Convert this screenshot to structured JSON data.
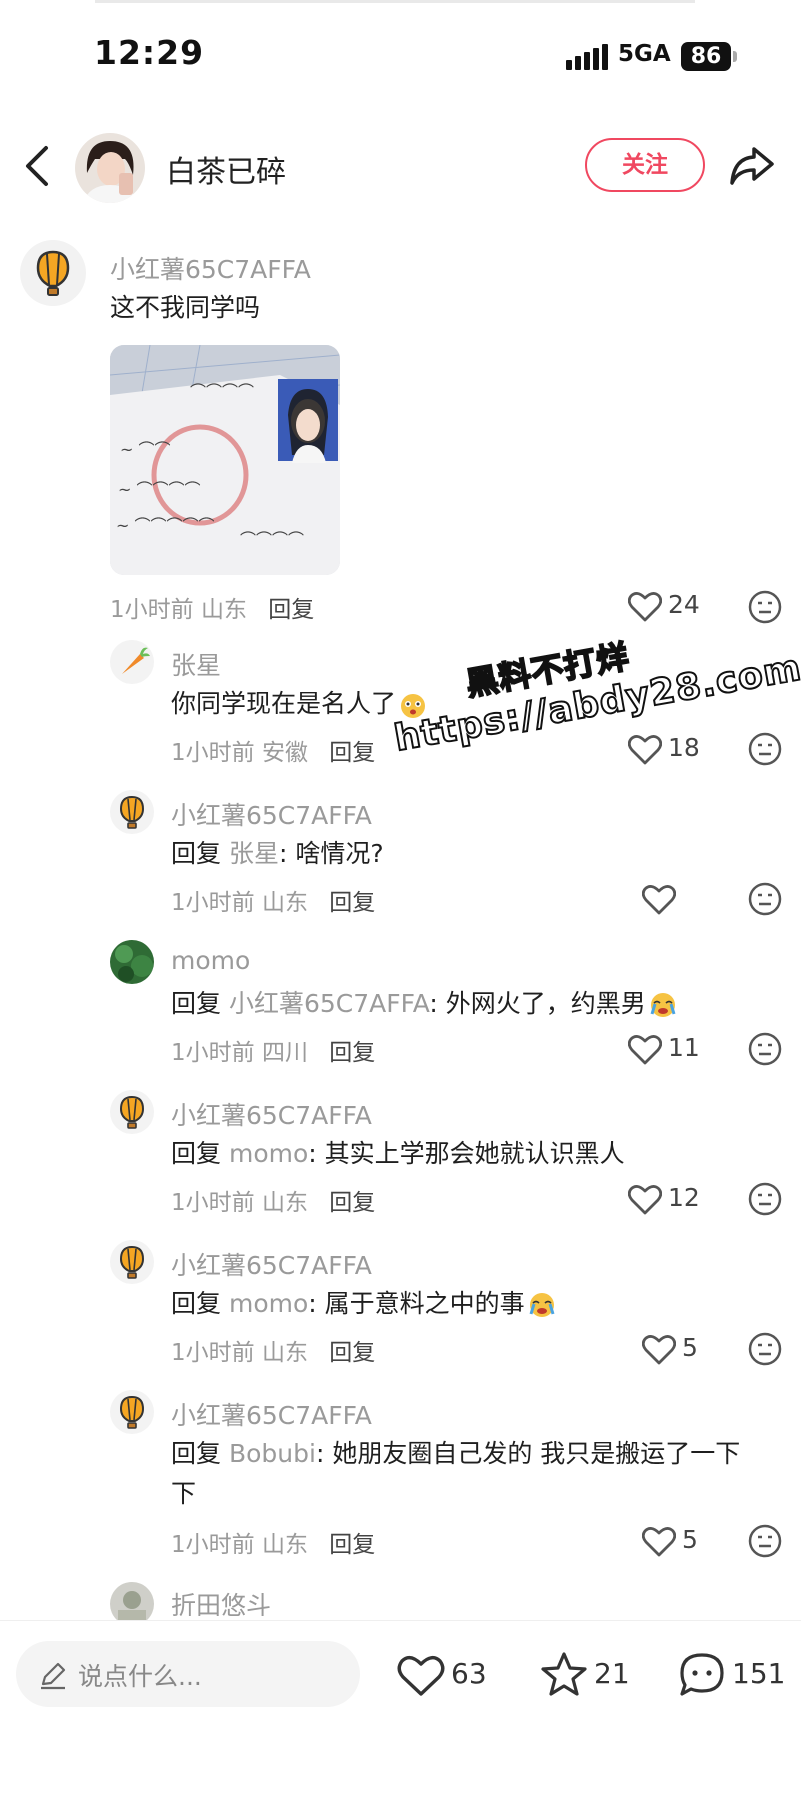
{
  "status": {
    "time": "12:29",
    "network": "5GA",
    "battery": "86"
  },
  "header": {
    "author_name": "白茶已碎",
    "follow_label": "关注"
  },
  "comments": [
    {
      "user": "小红薯65C7AFFA",
      "text": "这不我同学吗",
      "time": "1小时前",
      "location": "山东",
      "reply": "回复",
      "likes": "24"
    },
    {
      "user": "张星",
      "text": "你同学现在是名人了",
      "time": "1小时前",
      "location": "安徽",
      "reply": "回复",
      "likes": "18"
    },
    {
      "user": "小红薯65C7AFFA",
      "prefix": "回复",
      "mention": "张星",
      "text": ": 啥情况?",
      "time": "1小时前",
      "location": "山东",
      "reply": "回复",
      "likes": ""
    },
    {
      "user": "momo",
      "prefix": "回复",
      "mention": "小红薯65C7AFFA",
      "text": ": 外网火了，约黑男",
      "time": "1小时前",
      "location": "四川",
      "reply": "回复",
      "likes": "11"
    },
    {
      "user": "小红薯65C7AFFA",
      "prefix": "回复",
      "mention": "momo",
      "text": ": 其实上学那会她就认识黑人",
      "time": "1小时前",
      "location": "山东",
      "reply": "回复",
      "likes": "12"
    },
    {
      "user": "小红薯65C7AFFA",
      "prefix": "回复",
      "mention": "momo",
      "text": ": 属于意料之中的事",
      "time": "1小时前",
      "location": "山东",
      "reply": "回复",
      "likes": "5"
    },
    {
      "user": "小红薯65C7AFFA",
      "prefix": "回复",
      "mention": "Bobubi",
      "text": ": 她朋友圈自己发的 我只是搬运了一下",
      "text2": "下",
      "time": "1小时前",
      "location": "山东",
      "reply": "回复",
      "likes": "5"
    },
    {
      "user": "折田悠斗"
    }
  ],
  "watermark": {
    "line1": "黑料不打烊",
    "line2": "https://abdy28.com"
  },
  "bottom": {
    "input_placeholder": "说点什么...",
    "likes": "63",
    "collects": "21",
    "comments": "151"
  },
  "colors": {
    "accent": "#f04860",
    "muted": "#9a9a9a"
  }
}
